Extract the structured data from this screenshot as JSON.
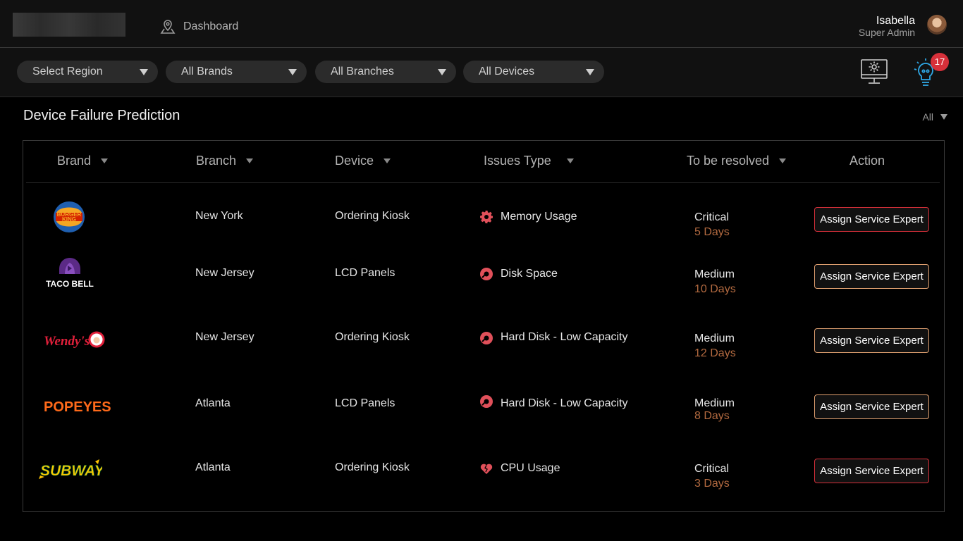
{
  "topbar": {
    "nav_dashboard": "Dashboard",
    "user_name": "Isabella",
    "user_role": "Super Admin"
  },
  "filters": {
    "region": "Select Region",
    "brands": "All Brands",
    "branches": "All Branches",
    "devices": "All Devices"
  },
  "notifications": {
    "count": "17"
  },
  "section": {
    "title": "Device Failure Prediction",
    "filter_value": "All"
  },
  "table": {
    "headers": {
      "brand": "Brand",
      "branch": "Branch",
      "device": "Device",
      "issues_type": "Issues Type",
      "to_be_resolved": "To be resolved",
      "action": "Action"
    },
    "rows": [
      {
        "brand": "Burger King",
        "branch": "New York",
        "device": "Ordering Kiosk",
        "issue_icon": "gear-icon",
        "issue": "Memory Usage",
        "severity": "Critical",
        "days": "5 Days",
        "action": "Assign Service Expert"
      },
      {
        "brand": "Taco Bell",
        "branch": "New Jersey",
        "device": "LCD Panels",
        "issue_icon": "disk-icon",
        "issue": "Disk Space",
        "severity": "Medium",
        "days": "10 Days",
        "action": "Assign Service Expert"
      },
      {
        "brand": "Wendy's",
        "branch": "New Jersey",
        "device": "Ordering Kiosk",
        "issue_icon": "disk-icon",
        "issue": "Hard Disk - Low Capacity",
        "severity": "Medium",
        "days": "12 Days",
        "action": "Assign Service Expert"
      },
      {
        "brand": "Popeyes",
        "branch": "Atlanta",
        "device": "LCD Panels",
        "issue_icon": "disk-icon",
        "issue": "Hard Disk - Low Capacity",
        "severity": "Medium",
        "days": "8 Days",
        "action": "Assign Service Expert"
      },
      {
        "brand": "Subway",
        "branch": "Atlanta",
        "device": "Ordering Kiosk",
        "issue_icon": "broken-heart-icon",
        "issue": "CPU Usage",
        "severity": "Critical",
        "days": "3 Days",
        "action": "Assign Service Expert"
      }
    ]
  },
  "logo_text": {
    "burger_king": [
      "BURGER",
      "KING"
    ],
    "taco_bell": "TACO BELL",
    "wendys": "Wendy's",
    "popeyes": "POPEYES",
    "subway": "SUBWAY"
  },
  "colors": {
    "critical_border": "#d7303a",
    "medium_border": "#e0a070",
    "days_text": "#b36a40",
    "issue_icon": "#e0505a",
    "badge": "#d7303a",
    "notify_icon": "#2fa8e6"
  }
}
